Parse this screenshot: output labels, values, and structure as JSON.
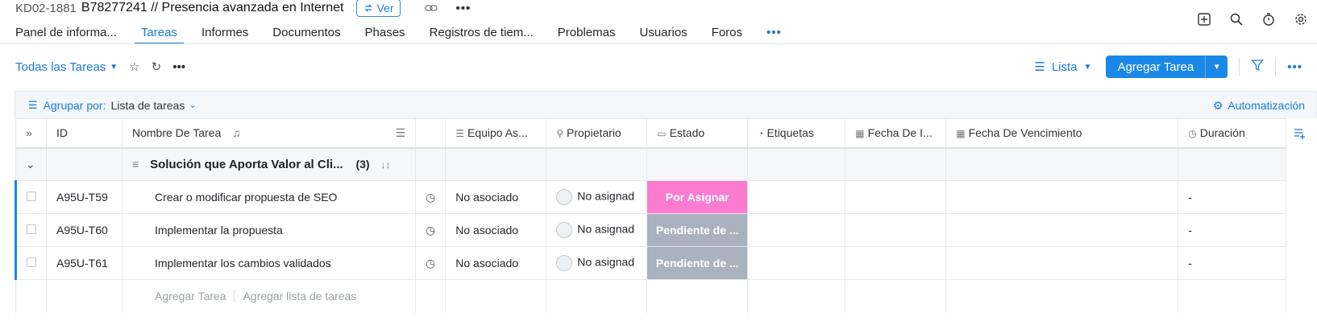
{
  "header": {
    "project_id": "KD02-1881",
    "project_name": "B78277241 // Presencia avanzada en Internet",
    "ver_label": "Ver",
    "more_label": "•••"
  },
  "tabs": [
    {
      "label": "Panel de informa..."
    },
    {
      "label": "Tareas"
    },
    {
      "label": "Informes"
    },
    {
      "label": "Documentos"
    },
    {
      "label": "Phases"
    },
    {
      "label": "Registros de tiem..."
    },
    {
      "label": "Problemas"
    },
    {
      "label": "Usuarios"
    },
    {
      "label": "Foros"
    }
  ],
  "tabs_more": "•••",
  "toolbar": {
    "view_label": "Todas las Tareas",
    "lista_label": "Lista",
    "add_task_label": "Agregar Tarea",
    "more_label": "•••"
  },
  "groupbar": {
    "label": "Agrupar por:",
    "value": "Lista de tareas",
    "automation_label": "Automatización"
  },
  "columns": {
    "id": "ID",
    "name": "Nombre De Tarea",
    "team": "Equipo As...",
    "owner": "Propietario",
    "status": "Estado",
    "tags": "Etiquetas",
    "start": "Fecha De I...",
    "due": "Fecha De Vencimiento",
    "duration": "Duración"
  },
  "group": {
    "name": "Solución que Aporta Valor al Cli...",
    "count": "(3)"
  },
  "tasks": [
    {
      "id": "A95U-T59",
      "name": "Crear o modificar propuesta de SEO",
      "team": "No asociado",
      "owner": "No asignad",
      "status": "Por Asignar",
      "status_color": "#fb7bd0",
      "duration": "-"
    },
    {
      "id": "A95U-T60",
      "name": "Implementar la propuesta",
      "team": "No asociado",
      "owner": "No asignad",
      "status": "Pendiente de ...",
      "status_color": "#a9b2be",
      "duration": "-"
    },
    {
      "id": "A95U-T61",
      "name": "Implementar los cambios validados",
      "team": "No asociado",
      "owner": "No asignad",
      "status": "Pendiente de ...",
      "status_color": "#a9b2be",
      "duration": "-"
    }
  ],
  "add_row": {
    "add_task": "Agregar Tarea",
    "add_list": "Agregar lista de tareas"
  },
  "colors": {
    "accent": "#1a88e6",
    "status_por_asignar": "#fb7bd0",
    "status_pendiente": "#a9b2be"
  }
}
